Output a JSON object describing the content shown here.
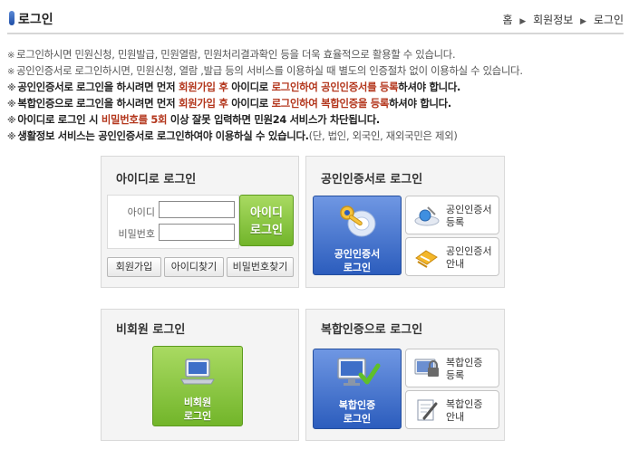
{
  "header": {
    "title": "로그인",
    "breadcrumb": [
      "홈",
      "회원정보",
      "로그인"
    ],
    "breadcrumb_sep": "▶"
  },
  "notices": {
    "mark": "※",
    "n1": "로그인하시면 민원신청, 민원발급, 민원열람, 민원처리결과확인 등을 더욱 효율적으로 활용할 수 있습니다.",
    "n2": "공인인증서로 로그인하시면, 민원신청, 열람 ,발급 등의 서비스를 이용하실 때 별도의 인증절차 없이 이용하실 수 있습니다.",
    "n3a": "공인인증서로 로그인을 하시려면 먼저 ",
    "n3b": "회원가입 후",
    "n3c": " 아이디로 ",
    "n3d": "로그인하여 공인인증서를 등록",
    "n3e": "하셔야 합니다.",
    "n4a": "복합인증으로 로그인을 하시려면 먼저 ",
    "n4b": "회원가입 후",
    "n4c": " 아이디로 ",
    "n4d": "로그인하여 복합인증을 등록",
    "n4e": "하셔야 합니다.",
    "n5a": "아이디로 로그인 시 ",
    "n5b": "비밀번호를 5회",
    "n5c": " 이상 잘못 입력하면 민원24 서비스가 차단됩니다.",
    "n6a": "생활정보 서비스는 공인인증서로 로그인하여야 이용하실 수 있습니다.",
    "n6b": "(단, 법인, 외국인, 재외국민은 제외)"
  },
  "id_login": {
    "title": "아이디로 로그인",
    "id_label": "아이디",
    "pw_label": "비밀번호",
    "id_value": "",
    "pw_value": "",
    "login_line1": "아이디",
    "login_line2": "로그인",
    "join": "회원가입",
    "find_id": "아이디찾기",
    "find_pw": "비밀번호찾기"
  },
  "cert_login": {
    "title": "공인인증서로 로그인",
    "login_line1": "공인인증서",
    "login_line2": "로그인",
    "register_line1": "공인인증서",
    "register_line2": "등록",
    "guide_line1": "공인인증서",
    "guide_line2": "안내"
  },
  "guest_login": {
    "title": "비회원 로그인",
    "line1": "비회원",
    "line2": "로그인"
  },
  "multi_login": {
    "title": "복합인증으로 로그인",
    "login_line1": "복합인증",
    "login_line2": "로그인",
    "register_line1": "복합인증",
    "register_line2": "등록",
    "guide_line1": "복합인증",
    "guide_line2": "안내"
  },
  "colors": {
    "accent_red": "#b3361c",
    "green": "#72b52a",
    "blue": "#2c5dbd"
  }
}
